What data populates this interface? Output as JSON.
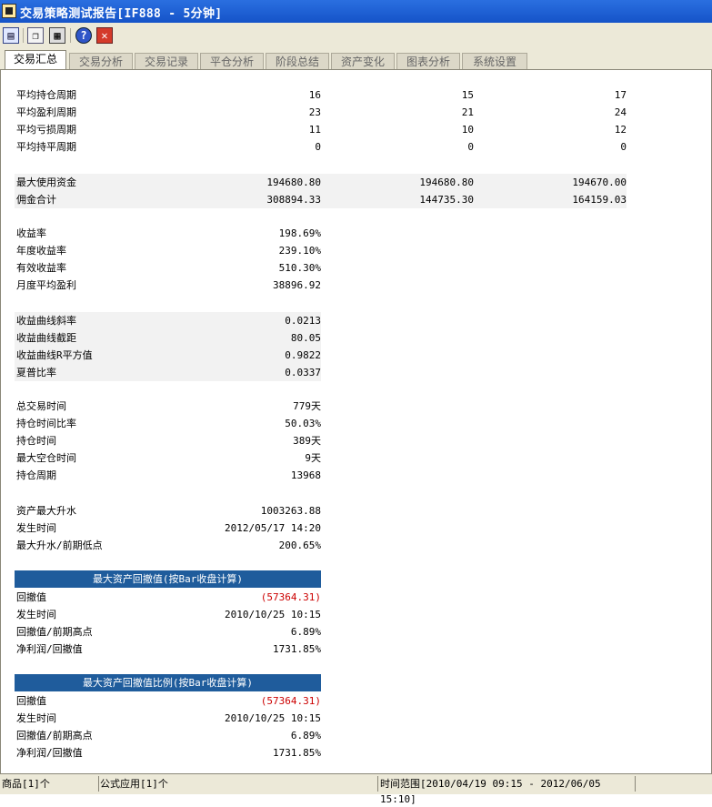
{
  "window": {
    "title": "交易策略测试报告[IF888 - 5分钟]"
  },
  "toolbar": {
    "icons": [
      "report-icon",
      "copy-icon",
      "print-icon",
      "help-icon",
      "close-icon"
    ],
    "help_glyph": "?",
    "close_glyph": "✕"
  },
  "tabs": [
    "交易汇总",
    "交易分析",
    "交易记录",
    "平仓分析",
    "阶段总结",
    "资产变化",
    "图表分析",
    "系统设置"
  ],
  "summary": {
    "period_rows": [
      {
        "label": "平均持仓周期",
        "v1": "16",
        "v2": "15",
        "v3": "17"
      },
      {
        "label": "平均盈利周期",
        "v1": "23",
        "v2": "21",
        "v3": "24"
      },
      {
        "label": "平均亏损周期",
        "v1": "11",
        "v2": "10",
        "v3": "12"
      },
      {
        "label": "平均持平周期",
        "v1": "0",
        "v2": "0",
        "v3": "0"
      }
    ],
    "capital_rows": [
      {
        "label": "最大使用资金",
        "v1": "194680.80",
        "v2": "194680.80",
        "v3": "194670.00"
      },
      {
        "label": "佣金合计",
        "v1": "308894.33",
        "v2": "144735.30",
        "v3": "164159.03"
      }
    ],
    "return_rows": [
      {
        "label": "收益率",
        "value": "198.69%"
      },
      {
        "label": "年度收益率",
        "value": "239.10%"
      },
      {
        "label": "有效收益率",
        "value": "510.30%"
      },
      {
        "label": "月度平均盈利",
        "value": "38896.92"
      }
    ],
    "curve_rows": [
      {
        "label": "收益曲线斜率",
        "value": "0.0213"
      },
      {
        "label": "收益曲线截距",
        "value": "80.05"
      },
      {
        "label": "收益曲线R平方值",
        "value": "0.9822"
      },
      {
        "label": "夏普比率",
        "value": "0.0337"
      }
    ],
    "time_rows": [
      {
        "label": "总交易时间",
        "value": "779天"
      },
      {
        "label": "持仓时间比率",
        "value": "50.03%"
      },
      {
        "label": "持仓时间",
        "value": "389天"
      },
      {
        "label": "最大空仓时间",
        "value": "9天"
      },
      {
        "label": "持仓周期",
        "value": "13968"
      }
    ],
    "rise_rows": [
      {
        "label": "资产最大升水",
        "value": "1003263.88"
      },
      {
        "label": "发生时间",
        "value": "2012/05/17 14:20"
      },
      {
        "label": "最大升水/前期低点",
        "value": "200.65%"
      }
    ],
    "drawdown_value": {
      "header": "最大资产回撤值(按Bar收盘计算)",
      "rows": [
        {
          "label": "回撤值",
          "value": "(57364.31)"
        },
        {
          "label": "发生时间",
          "value": "2010/10/25 10:15"
        },
        {
          "label": "回撤值/前期高点",
          "value": "6.89%"
        },
        {
          "label": "净利润/回撤值",
          "value": "1731.85%"
        }
      ]
    },
    "drawdown_ratio": {
      "header": "最大资产回撤值比例(按Bar收盘计算)",
      "rows": [
        {
          "label": "回撤值",
          "value": "(57364.31)"
        },
        {
          "label": "发生时间",
          "value": "2010/10/25 10:15"
        },
        {
          "label": "回撤值/前期高点",
          "value": "6.89%"
        },
        {
          "label": "净利润/回撤值",
          "value": "1731.85%"
        }
      ]
    }
  },
  "colors": {
    "negative": "#cc0000",
    "header_bg": "#1f5c9c",
    "title_bar": "#1553c8"
  },
  "statusbar": {
    "products": "商品[1]个",
    "formulas": "公式应用[1]个",
    "time_range": "时间范围[2010/04/19 09:15 - 2012/06/05 15:10]"
  }
}
